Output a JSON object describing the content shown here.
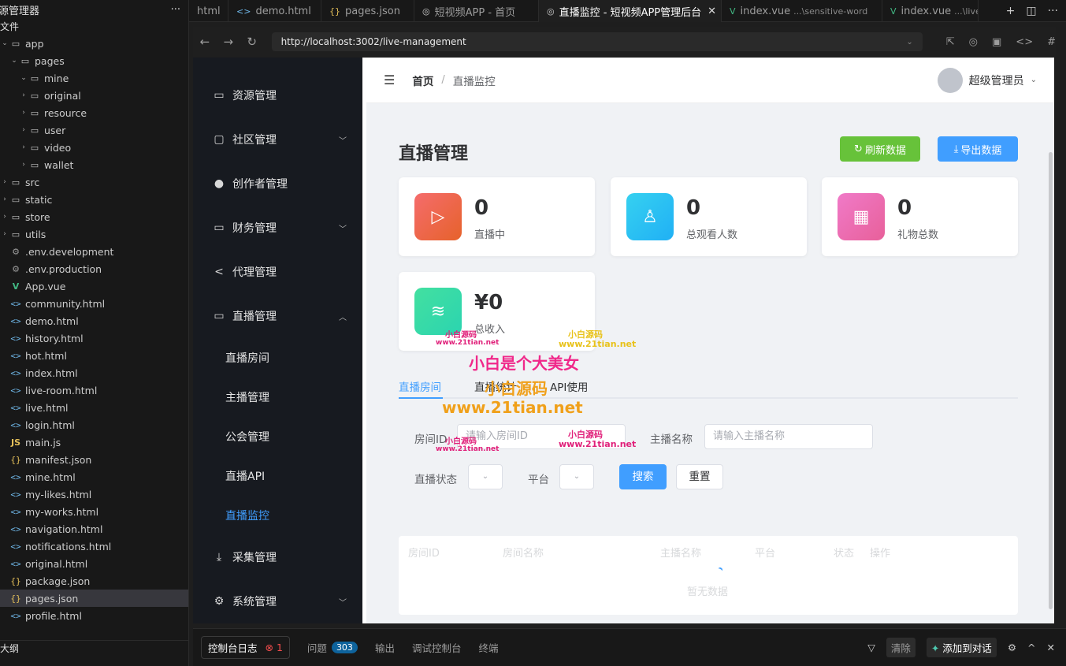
{
  "explorer": {
    "title": "源管理器",
    "files_section": "文件",
    "outline_section": "大纲",
    "items": [
      {
        "label": "app",
        "icon": "folder-open-icon",
        "arrow": "v",
        "indent": 0,
        "kind": "folder"
      },
      {
        "label": "pages",
        "icon": "folder-open-icon",
        "arrow": "v",
        "indent": 1,
        "kind": "folder"
      },
      {
        "label": "mine",
        "icon": "folder-open-icon",
        "arrow": "v",
        "indent": 2,
        "kind": "folder"
      },
      {
        "label": "original",
        "icon": "folder-icon",
        "arrow": ">",
        "indent": 2,
        "kind": "folder"
      },
      {
        "label": "resource",
        "icon": "folder-icon",
        "arrow": ">",
        "indent": 2,
        "kind": "folder"
      },
      {
        "label": "user",
        "icon": "folder-icon",
        "arrow": ">",
        "indent": 2,
        "kind": "folder"
      },
      {
        "label": "video",
        "icon": "folder-icon",
        "arrow": ">",
        "indent": 2,
        "kind": "folder"
      },
      {
        "label": "wallet",
        "icon": "folder-icon",
        "arrow": ">",
        "indent": 2,
        "kind": "folder"
      },
      {
        "label": "src",
        "icon": "folder-icon",
        "arrow": ">",
        "indent": 0,
        "kind": "folder"
      },
      {
        "label": "static",
        "icon": "folder-icon",
        "arrow": ">",
        "indent": 0,
        "kind": "folder"
      },
      {
        "label": "store",
        "icon": "folder-icon",
        "arrow": ">",
        "indent": 0,
        "kind": "folder"
      },
      {
        "label": "utils",
        "icon": "folder-icon",
        "arrow": ">",
        "indent": 0,
        "kind": "folder"
      },
      {
        "label": ".env.development",
        "icon": "gear-icon",
        "arrow": "",
        "indent": 0,
        "kind": "gear"
      },
      {
        "label": ".env.production",
        "icon": "gear-icon",
        "arrow": "",
        "indent": 0,
        "kind": "gear"
      },
      {
        "label": "App.vue",
        "icon": "vue-icon",
        "arrow": "",
        "indent": 0,
        "kind": "vue"
      },
      {
        "label": "community.html",
        "icon": "html-icon",
        "arrow": "",
        "indent": 0,
        "kind": "html"
      },
      {
        "label": "demo.html",
        "icon": "html-icon",
        "arrow": "",
        "indent": 0,
        "kind": "html"
      },
      {
        "label": "history.html",
        "icon": "html-icon",
        "arrow": "",
        "indent": 0,
        "kind": "html"
      },
      {
        "label": "hot.html",
        "icon": "html-icon",
        "arrow": "",
        "indent": 0,
        "kind": "html"
      },
      {
        "label": "index.html",
        "icon": "html-icon",
        "arrow": "",
        "indent": 0,
        "kind": "html"
      },
      {
        "label": "live-room.html",
        "icon": "html-icon",
        "arrow": "",
        "indent": 0,
        "kind": "html"
      },
      {
        "label": "live.html",
        "icon": "html-icon",
        "arrow": "",
        "indent": 0,
        "kind": "html"
      },
      {
        "label": "login.html",
        "icon": "html-icon",
        "arrow": "",
        "indent": 0,
        "kind": "html"
      },
      {
        "label": "main.js",
        "icon": "js-icon",
        "arrow": "",
        "indent": 0,
        "kind": "js"
      },
      {
        "label": "manifest.json",
        "icon": "json-icon",
        "arrow": "",
        "indent": 0,
        "kind": "json"
      },
      {
        "label": "mine.html",
        "icon": "html-icon",
        "arrow": "",
        "indent": 0,
        "kind": "html"
      },
      {
        "label": "my-likes.html",
        "icon": "html-icon",
        "arrow": "",
        "indent": 0,
        "kind": "html"
      },
      {
        "label": "my-works.html",
        "icon": "html-icon",
        "arrow": "",
        "indent": 0,
        "kind": "html"
      },
      {
        "label": "navigation.html",
        "icon": "html-icon",
        "arrow": "",
        "indent": 0,
        "kind": "html"
      },
      {
        "label": "notifications.html",
        "icon": "html-icon",
        "arrow": "",
        "indent": 0,
        "kind": "html"
      },
      {
        "label": "original.html",
        "icon": "html-icon",
        "arrow": "",
        "indent": 0,
        "kind": "html"
      },
      {
        "label": "package.json",
        "icon": "json-icon",
        "arrow": "",
        "indent": 0,
        "kind": "json"
      },
      {
        "label": "pages.json",
        "icon": "json-icon",
        "arrow": "",
        "indent": 0,
        "kind": "json",
        "selected": true
      },
      {
        "label": "profile.html",
        "icon": "html-icon",
        "arrow": "",
        "indent": 0,
        "kind": "html"
      }
    ]
  },
  "tabs": [
    {
      "label": "html",
      "icon": "",
      "sub": "",
      "active": false
    },
    {
      "label": "demo.html",
      "icon": "<>",
      "sub": "",
      "active": false
    },
    {
      "label": "pages.json",
      "icon": "{}",
      "sub": "",
      "active": false
    },
    {
      "label": "短视频APP - 首页",
      "icon": "◎",
      "sub": "",
      "active": false
    },
    {
      "label": "直播监控 - 短视频APP管理后台",
      "icon": "◎",
      "sub": "",
      "active": true
    },
    {
      "label": "index.vue",
      "icon": "V",
      "sub": "...\\sensitive-word",
      "active": false
    },
    {
      "label": "index.vue",
      "icon": "V",
      "sub": "...\\live",
      "active": false
    }
  ],
  "browser": {
    "url": "http://localhost:3002/live-management"
  },
  "app": {
    "menu": [
      {
        "label": "资源管理",
        "icon": "folder-icon",
        "glyph": "▭",
        "chevron": ""
      },
      {
        "label": "社区管理",
        "icon": "chat-icon",
        "glyph": "▢",
        "chevron": "v"
      },
      {
        "label": "创作者管理",
        "icon": "user-icon",
        "glyph": "●",
        "chevron": ""
      },
      {
        "label": "财务管理",
        "icon": "finance-icon",
        "glyph": "▭",
        "chevron": "v"
      },
      {
        "label": "代理管理",
        "icon": "share-icon",
        "glyph": "<",
        "chevron": ""
      },
      {
        "label": "直播管理",
        "icon": "video-icon",
        "glyph": "▭",
        "chevron": "^"
      }
    ],
    "submenu": [
      {
        "label": "直播房间",
        "active": false
      },
      {
        "label": "主播管理",
        "active": false
      },
      {
        "label": "公会管理",
        "active": false
      },
      {
        "label": "直播API",
        "active": false
      },
      {
        "label": "直播监控",
        "active": true
      }
    ],
    "menu_bottom": [
      {
        "label": "采集管理",
        "icon": "download-icon",
        "glyph": "⤓",
        "chevron": ""
      },
      {
        "label": "系统管理",
        "icon": "gear-icon",
        "glyph": "⚙",
        "chevron": "v"
      }
    ],
    "breadcrumb": {
      "home": "首页",
      "current": "直播监控"
    },
    "user": "超级管理员",
    "page_title": "直播管理",
    "buttons": {
      "refresh": "刷新数据",
      "export": "导出数据",
      "search": "搜索",
      "reset": "重置"
    },
    "stats": [
      {
        "value": "0",
        "label": "直播中",
        "icon": "play-icon",
        "color_from": "#f56c6c",
        "color_to": "#e6622b"
      },
      {
        "value": "0",
        "label": "总观看人数",
        "icon": "user-icon",
        "color_from": "#36d1f0",
        "color_to": "#20b0f5"
      },
      {
        "value": "0",
        "label": "礼物总数",
        "icon": "gift-icon",
        "color_from": "#f07ac8",
        "color_to": "#e8609a"
      },
      {
        "value": "¥0",
        "label": "总收入",
        "icon": "coins-icon",
        "color_from": "#43e0a0",
        "color_to": "#2bd4b0"
      }
    ],
    "subtabs": [
      "直播房间",
      "直播统计",
      "API使用"
    ],
    "filters": {
      "room_id_label": "房间ID",
      "room_id_placeholder": "请输入房间ID",
      "anchor_label": "主播名称",
      "anchor_placeholder": "请输入主播名称",
      "status_label": "直播状态",
      "platform_label": "平台"
    },
    "table": {
      "headers": [
        "房间ID",
        "房间名称",
        "主播名称",
        "平台",
        "状态",
        "操作"
      ],
      "empty": "暂无数据"
    }
  },
  "watermark": {
    "small_a": "小白源码",
    "small_a_url": "www.21tian.net",
    "big_line1": "小白是个大美女",
    "big_line2": "小白源码",
    "big_url": "www.21tian.net"
  },
  "panel": {
    "console": "控制台日志",
    "errors": "1",
    "problems": "问题",
    "problems_count": "303",
    "output": "输出",
    "debug": "调试控制台",
    "terminal": "终端",
    "clear": "清除",
    "add_chat": "添加到对话"
  }
}
